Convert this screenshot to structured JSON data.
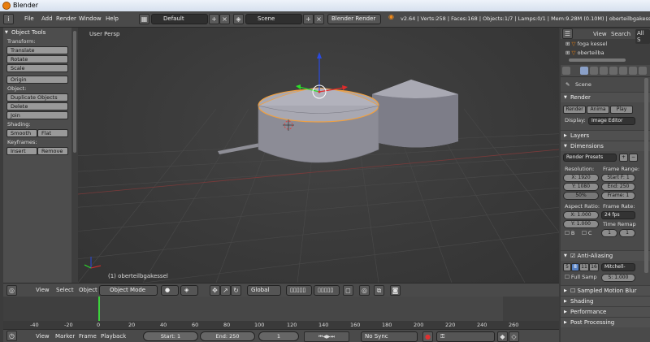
{
  "window": {
    "title": "Blender"
  },
  "info_header": {
    "menus": [
      "File",
      "Add",
      "Render",
      "Window",
      "Help"
    ],
    "layout": "Default",
    "scene": "Scene",
    "engine": "Blender Render",
    "stats": "v2.64 | Verts:258 | Faces:168 | Objects:1/7 | Lamps:0/1 | Mem:9.28M (0.10M) | oberteilbgakessel"
  },
  "tool_shelf": {
    "title": "Object Tools",
    "transform_label": "Transform:",
    "translate": "Translate",
    "rotate": "Rotate",
    "scale": "Scale",
    "origin": "Origin",
    "object_label": "Object:",
    "duplicate": "Duplicate Objects",
    "delete": "Delete",
    "join": "Join",
    "shading_label": "Shading:",
    "smooth": "Smooth",
    "flat": "Flat",
    "keyframes_label": "Keyframes:",
    "insert": "Insert",
    "remove": "Remove"
  },
  "viewport": {
    "view_name": "User Persp",
    "object_name": "(1) oberteilbgakessel"
  },
  "viewport_header": {
    "menus": [
      "View",
      "Select",
      "Object"
    ],
    "mode": "Object Mode",
    "orientation": "Global"
  },
  "timeline": {
    "ticks": [
      "-40",
      "-20",
      "0",
      "20",
      "40",
      "60",
      "80",
      "100",
      "120",
      "140",
      "160",
      "180",
      "200",
      "220",
      "240",
      "260"
    ],
    "menus": [
      "View",
      "Marker",
      "Frame",
      "Playback"
    ],
    "start": "Start: 1",
    "end": "End: 250",
    "current": "1",
    "sync": "No Sync"
  },
  "outliner": {
    "view": "View",
    "search": "Search",
    "all": "All S",
    "items": [
      "foga kessel",
      "oberteilba"
    ]
  },
  "properties": {
    "scene_path": "Scene",
    "render_section": "Render",
    "render_btn": "Render",
    "anim_btn": "Anima",
    "play_btn": "Play",
    "display_label": "Display:",
    "display_value": "Image Editor",
    "layers": "Layers",
    "dimensions": "Dimensions",
    "presets": "Render Presets",
    "resolution_label": "Resolution:",
    "res_x": "X: 1920",
    "res_y": "Y: 1080",
    "res_pct": "50%",
    "frame_range_label": "Frame Range:",
    "start_f": "Start F: 1",
    "end_f": "End: 250",
    "frame": "Frame: 1",
    "aspect_label": "Aspect Ratio:",
    "aspect_x": "X: 1.000",
    "aspect_y": "Y: 1.000",
    "frame_rate_label": "Frame Rate:",
    "fps": "24 fps",
    "time_remap": "Time Remap",
    "remap_old": "1",
    "remap_new": "1",
    "border_b": "B",
    "border_c": "C",
    "aa": "Anti-Aliasing",
    "aa_samples": [
      "5",
      "8",
      "11",
      "16"
    ],
    "aa_filter": "Mitchell-",
    "full_sample": "Full Samp",
    "aa_size": "S: 1.000",
    "motion_blur": "Sampled Motion Blur",
    "shading": "Shading",
    "performance": "Performance",
    "post_processing": "Post Processing"
  },
  "colors": {
    "accent": "#e87d0d",
    "selection_outline": "#f0a040",
    "frame_cursor": "#3cd33c"
  }
}
